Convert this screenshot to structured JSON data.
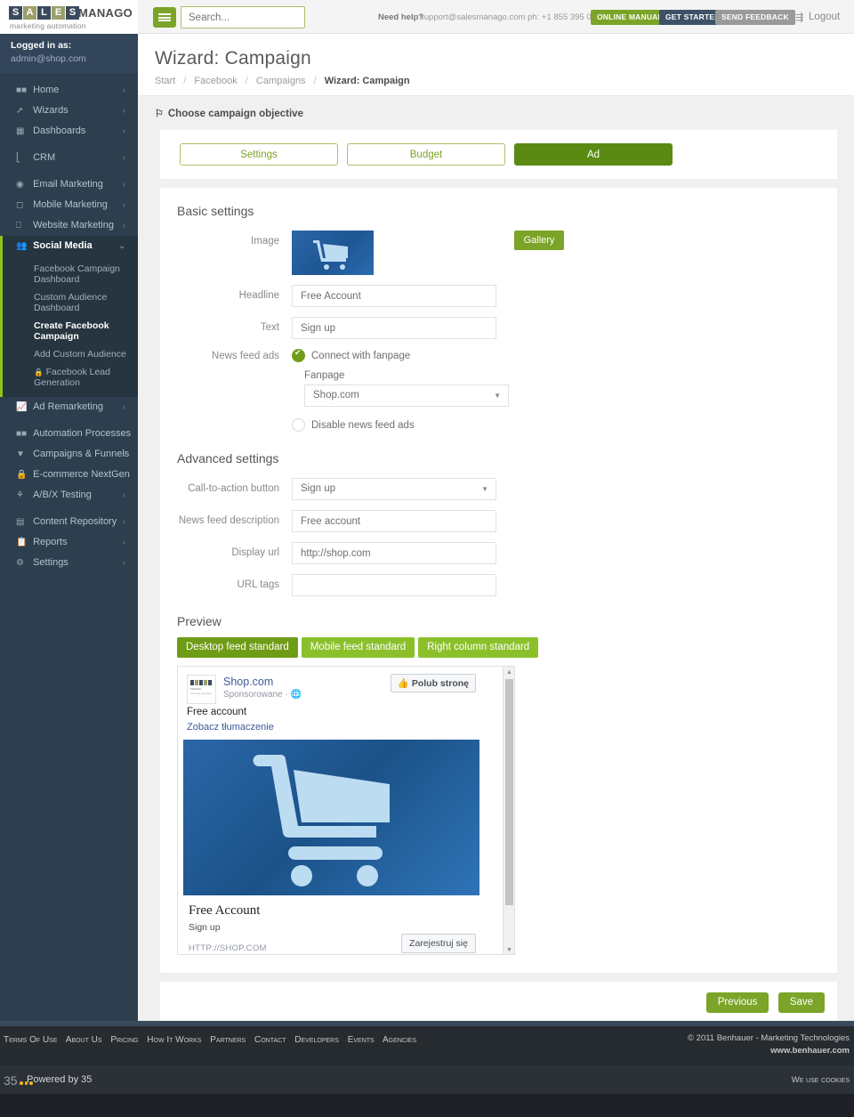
{
  "brand": {
    "logo_letters": [
      "S",
      "A",
      "L",
      "E",
      "S"
    ],
    "logo_word": "MANAGO",
    "logo_tagline": "marketing automation"
  },
  "topbar": {
    "menu_icon": "hamburger-icon",
    "search_placeholder": "Search...",
    "search_value": "",
    "need_help": "Need help?",
    "support": "support@salesmanago.com ph: +1 855 395 0027",
    "btn_online_manual": "ONLINE MANUAL",
    "btn_get_started": "GET STARTED",
    "btn_send_feedback": "SEND FEEDBACK",
    "logout": "Logout",
    "logout_icon": "logout-icon",
    "colors": {
      "green": "#7ba428",
      "navy": "#3e5166",
      "grey": "#9a9a9a"
    }
  },
  "sidebar": {
    "logged_in_label": "Logged in as:",
    "logged_in_email": "admin@shop.com",
    "items": [
      {
        "label": "Home",
        "icon": "grid-icon",
        "caret": "‹"
      },
      {
        "label": "Wizards",
        "icon": "wand-icon",
        "caret": "‹"
      },
      {
        "label": "Dashboards",
        "icon": "chart-icon",
        "caret": "‹"
      },
      {
        "label": "CRM",
        "icon": "bars-icon",
        "caret": "‹"
      },
      {
        "label": "Email Marketing",
        "icon": "at-icon",
        "caret": "‹"
      },
      {
        "label": "Mobile Marketing",
        "icon": "mobile-icon",
        "caret": "‹"
      },
      {
        "label": "Website Marketing",
        "icon": "monitor-icon",
        "caret": "‹"
      },
      {
        "label": "Social Media",
        "icon": "users-icon",
        "caret": "⌄"
      },
      {
        "label": "Ad Remarketing",
        "icon": "trend-icon",
        "caret": "‹"
      },
      {
        "label": "Automation Processes",
        "icon": "grid-icon",
        "caret": "‹"
      },
      {
        "label": "Campaigns & Funnels",
        "icon": "funnel-icon",
        "caret": "‹"
      },
      {
        "label": "E-commerce NextGen",
        "icon": "lock-icon",
        "caret": ""
      },
      {
        "label": "A/B/X Testing",
        "icon": "flask-icon",
        "caret": "‹"
      },
      {
        "label": "Content Repository",
        "icon": "stack-icon",
        "caret": "‹"
      },
      {
        "label": "Reports",
        "icon": "copy-icon",
        "caret": "‹"
      },
      {
        "label": "Settings",
        "icon": "gear-icon",
        "caret": "‹"
      }
    ],
    "submenu": [
      {
        "label": "Facebook Campaign Dashboard",
        "locked": false,
        "current": false
      },
      {
        "label": "Custom Audience Dashboard",
        "locked": false,
        "current": false
      },
      {
        "label": "Create Facebook Campaign",
        "locked": false,
        "current": true
      },
      {
        "label": "Add Custom Audience",
        "locked": false,
        "current": false
      },
      {
        "label": "Facebook Lead Generation",
        "locked": true,
        "current": false
      }
    ],
    "active_accent": "#8fc31f"
  },
  "page": {
    "title": "Wizard: Campaign",
    "breadcrumbs": [
      "Start",
      "Facebook",
      "Campaigns",
      "Wizard: Campaign"
    ],
    "objective_label": "Choose campaign objective",
    "objective_icon": "flag-icon"
  },
  "wizard_tabs": [
    {
      "label": "Settings",
      "active": false
    },
    {
      "label": "Budget",
      "active": false
    },
    {
      "label": "Ad",
      "active": true
    }
  ],
  "basic_settings": {
    "title": "Basic settings",
    "image_label": "Image",
    "image_icon": "shopping-cart-icon",
    "gallery_button": "Gallery",
    "headline_label": "Headline",
    "headline_value": "Free Account",
    "text_label": "Text",
    "text_value": "Sign up",
    "newsfeed_label": "News feed ads",
    "connect_fanpage_label": "Connect with fanpage",
    "connect_fanpage_selected": true,
    "fanpage_label": "Fanpage",
    "fanpage_value": "Shop.com",
    "disable_newsfeed_label": "Disable news feed ads",
    "disable_newsfeed_selected": false
  },
  "advanced_settings": {
    "title": "Advanced settings",
    "cta_label": "Call-to-action button",
    "cta_value": "Sign up",
    "desc_label": "News feed description",
    "desc_value": "Free account",
    "displayurl_label": "Display url",
    "displayurl_value": "http://shop.com",
    "urltags_label": "URL tags",
    "urltags_value": ""
  },
  "preview": {
    "title": "Preview",
    "tabs": [
      {
        "label": "Desktop feed standard",
        "active": true
      },
      {
        "label": "Mobile feed standard",
        "active": false
      },
      {
        "label": "Right column standard",
        "active": false
      }
    ],
    "card": {
      "page_name": "Shop.com",
      "meta": "Sponsorowane ·",
      "globe_icon": "globe-icon",
      "like_button": "Polub stronę",
      "like_icon": "thumbs-up-icon",
      "body_text": "Free account",
      "translate_link": "Zobacz tłumaczenie",
      "image_icon": "shopping-cart-icon",
      "title": "Free Account",
      "description": "Sign up",
      "url": "HTTP://SHOP.COM",
      "cta_button": "Zarejestruj się"
    },
    "scrollbar": {
      "up": "▲",
      "down": "▼"
    }
  },
  "actions": {
    "previous": "Previous",
    "save": "Save"
  },
  "footer": {
    "links": [
      "Terms Of Use",
      "About Us",
      "Pricing",
      "How It Works",
      "Partners",
      "Contact",
      "Developers",
      "Events",
      "Agencies"
    ],
    "copyright": "© 2011 Benhauer - Marketing Technologies",
    "website": "www.benhauer.com",
    "powered_mark": "35",
    "powered_by": "Powered by 35",
    "cookies": "We use cookies"
  }
}
